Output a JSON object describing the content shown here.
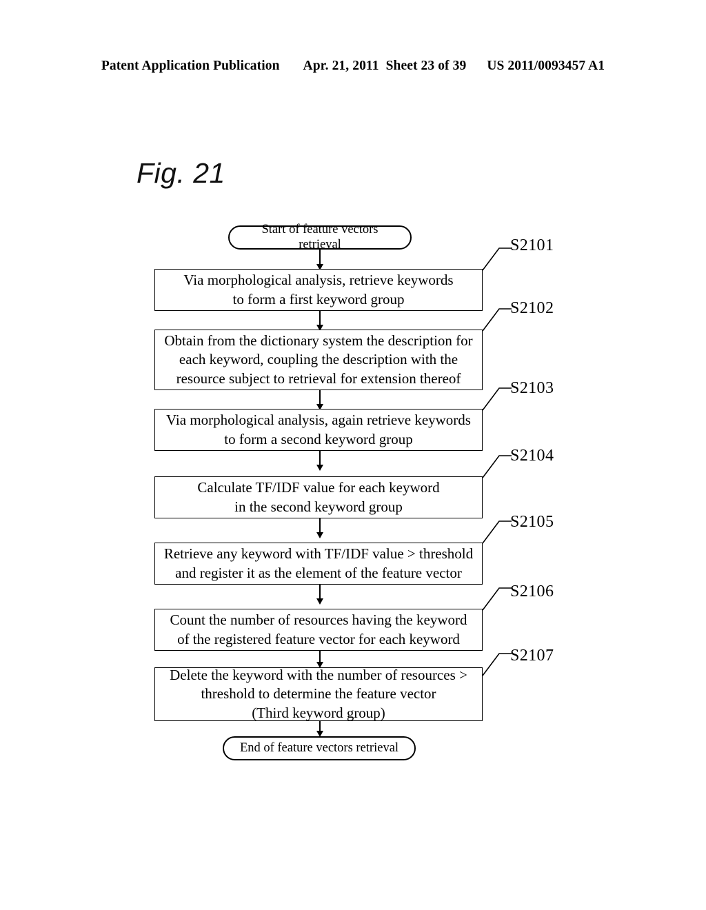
{
  "header": {
    "publication": "Patent Application Publication",
    "date": "Apr. 21, 2011",
    "sheet": "Sheet 23 of 39",
    "patent_number": "US 2011/0093457 A1"
  },
  "figure": {
    "label": "Fig. 21"
  },
  "flowchart": {
    "start": {
      "text": "Start of feature vectors retrieval"
    },
    "end": {
      "text": "End of feature vectors retrieval"
    },
    "steps": [
      {
        "id": "S2101",
        "lines": [
          "Via morphological analysis, retrieve keywords",
          "to form a first keyword group"
        ]
      },
      {
        "id": "S2102",
        "lines": [
          "Obtain from the dictionary system the description for",
          "each keyword, coupling the description with the",
          "resource subject to retrieval for extension thereof"
        ]
      },
      {
        "id": "S2103",
        "lines": [
          "Via morphological analysis, again retrieve keywords",
          "to form a second keyword group"
        ]
      },
      {
        "id": "S2104",
        "lines": [
          "Calculate TF/IDF value for each keyword",
          "in the second keyword group"
        ]
      },
      {
        "id": "S2105",
        "lines": [
          "Retrieve any keyword with TF/IDF value > threshold",
          "and register it as the element of the feature vector"
        ]
      },
      {
        "id": "S2106",
        "lines": [
          "Count the number of resources having the keyword",
          "of the registered feature vector for each keyword"
        ]
      },
      {
        "id": "S2107",
        "lines": [
          "Delete the keyword with the number of resources >",
          "threshold to determine the feature vector",
          "(Third keyword group)"
        ]
      }
    ]
  },
  "colors": {
    "ink": "#000000",
    "paper": "#ffffff"
  }
}
